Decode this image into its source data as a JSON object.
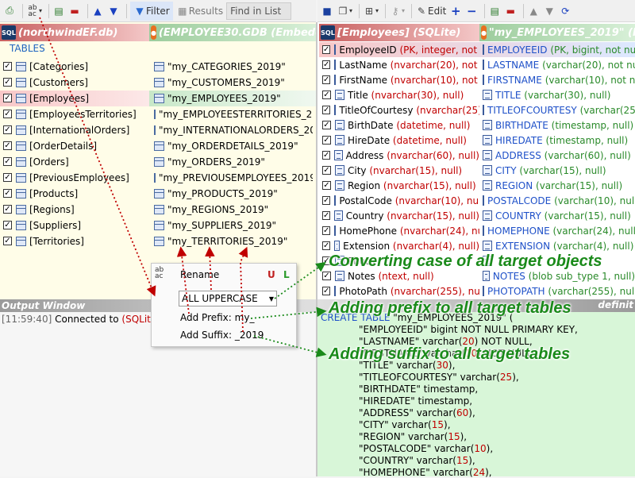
{
  "left_toolbar": {
    "filter_label": "Filter",
    "results_label": "Results",
    "find_placeholder": "Find in List"
  },
  "right_toolbar": {
    "edit_label": "Edit"
  },
  "source_db": {
    "title": "(northwindEF.db)",
    "logo_text": "SQL"
  },
  "target_db": {
    "title": "(EMPLOYEE30.GDB (Embedd",
    "logo_text": "●"
  },
  "tables_label": "TABLES",
  "tables": [
    {
      "src": "[Categories]",
      "dst": "\"my_CATEGORIES_2019\""
    },
    {
      "src": "[Customers]",
      "dst": "\"my_CUSTOMERS_2019\""
    },
    {
      "src": "[Employees]",
      "dst": "\"my_EMPLOYEES_2019\""
    },
    {
      "src": "[EmployeesTerritories]",
      "dst": "\"my_EMPLOYEESTERRITORIES_2019\""
    },
    {
      "src": "[InternationalOrders]",
      "dst": "\"my_INTERNATIONALORDERS_2019\""
    },
    {
      "src": "[OrderDetails]",
      "dst": "\"my_ORDERDETAILS_2019\""
    },
    {
      "src": "[Orders]",
      "dst": "\"my_ORDERS_2019\""
    },
    {
      "src": "[PreviousEmployees]",
      "dst": "\"my_PREVIOUSEMPLOYEES_2019\""
    },
    {
      "src": "[Products]",
      "dst": "\"my_PRODUCTS_2019\""
    },
    {
      "src": "[Regions]",
      "dst": "\"my_REGIONS_2019\""
    },
    {
      "src": "[Suppliers]",
      "dst": "\"my_SUPPLIERS_2019\""
    },
    {
      "src": "[Territories]",
      "dst": "\"my_TERRITORIES_2019\""
    }
  ],
  "src_table_header": "[Employees] (SQLite)",
  "dst_table_header": "\"my_EMPLOYEES_2019\" (Fir",
  "fields": [
    {
      "name": "EmployeeID",
      "stype": "(PK, integer, not nu",
      "dname": "EMPLOYEEID",
      "dtype": "(PK, bigint, not null"
    },
    {
      "name": "LastName",
      "stype": "(nvarchar(20), not nu",
      "dname": "LASTNAME",
      "dtype": "(varchar(20), not null"
    },
    {
      "name": "FirstName",
      "stype": "(nvarchar(10), not nu",
      "dname": "FIRSTNAME",
      "dtype": "(varchar(10), not null"
    },
    {
      "name": "Title",
      "stype": "(nvarchar(30), null)",
      "dname": "TITLE",
      "dtype": "(varchar(30), null)"
    },
    {
      "name": "TitleOfCourtesy",
      "stype": "(nvarchar(25), r",
      "dname": "TITLEOFCOURTESY",
      "dtype": "(varchar(25), n"
    },
    {
      "name": "BirthDate",
      "stype": "(datetime, null)",
      "dname": "BIRTHDATE",
      "dtype": "(timestamp, null)"
    },
    {
      "name": "HireDate",
      "stype": "(datetime, null)",
      "dname": "HIREDATE",
      "dtype": "(timestamp, null)"
    },
    {
      "name": "Address",
      "stype": "(nvarchar(60), null)",
      "dname": "ADDRESS",
      "dtype": "(varchar(60), null)"
    },
    {
      "name": "City",
      "stype": "(nvarchar(15), null)",
      "dname": "CITY",
      "dtype": "(varchar(15), null)"
    },
    {
      "name": "Region",
      "stype": "(nvarchar(15), null)",
      "dname": "REGION",
      "dtype": "(varchar(15), null)"
    },
    {
      "name": "PostalCode",
      "stype": "(nvarchar(10), null)",
      "dname": "POSTALCODE",
      "dtype": "(varchar(10), null)"
    },
    {
      "name": "Country",
      "stype": "(nvarchar(15), null)",
      "dname": "COUNTRY",
      "dtype": "(varchar(15), null)"
    },
    {
      "name": "HomePhone",
      "stype": "(nvarchar(24), null)",
      "dname": "HOMEPHONE",
      "dtype": "(varchar(24), null)"
    },
    {
      "name": "Extension",
      "stype": "(nvarchar(4), null)",
      "dname": "EXTENSION",
      "dtype": "(varchar(4), null)"
    },
    {
      "name": "Photo",
      "stype": "",
      "dname": "",
      "dtype": ""
    },
    {
      "name": "Notes",
      "stype": "(ntext, null)",
      "dname": "NOTES",
      "dtype": "(blob sub_type 1, null)"
    },
    {
      "name": "PhotoPath",
      "stype": "(nvarchar(255), null)",
      "dname": "PHOTOPATH",
      "dtype": "(varchar(255), null"
    }
  ],
  "output": {
    "title": "Output Window",
    "time": "[11:59:40]",
    "msg": "Connected to",
    "db": "(SQLite) nor"
  },
  "definition_label": "definit",
  "rename_popup": {
    "title": "Rename",
    "u": "U",
    "l": "L",
    "case_value": "ALL UPPERCASE",
    "prefix_label": "Add Prefix:",
    "prefix_value": "my_",
    "suffix_label": "Add Suffix:",
    "suffix_value": "_2019"
  },
  "sql_lines": [
    {
      "a": "CREATE TABLE",
      "b": " \"my_EMPLOYEES_2019\" ("
    },
    {
      "a": "\"EMPLOYEEID\" bigint",
      "b": " NOT NULL PRIMARY KEY,"
    },
    {
      "a": "\"LASTNAME\" varchar(",
      "n": "20",
      "b": ") NOT NULL,"
    },
    {
      "a": "\"FIRSTNAME\" varchar(",
      "n": "10",
      "b": ") NOT NULL,"
    },
    {
      "a": "\"TITLE\" varchar(",
      "n": "30",
      "b": "),"
    },
    {
      "a": "\"TITLEOFCOURTESY\" varchar(",
      "n": "25",
      "b": "),"
    },
    {
      "a": "\"BIRTHDATE\" timestamp,"
    },
    {
      "a": "\"HIREDATE\" timestamp,"
    },
    {
      "a": "\"ADDRESS\" varchar(",
      "n": "60",
      "b": "),"
    },
    {
      "a": "\"CITY\" varchar(",
      "n": "15",
      "b": "),"
    },
    {
      "a": "\"REGION\" varchar(",
      "n": "15",
      "b": "),"
    },
    {
      "a": "\"POSTALCODE\" varchar(",
      "n": "10",
      "b": "),"
    },
    {
      "a": "\"COUNTRY\" varchar(",
      "n": "15",
      "b": "),"
    },
    {
      "a": "\"HOMEPHONE\" varchar(",
      "n": "24",
      "b": "),"
    }
  ],
  "annotations": {
    "case": "Converting case of all target objects",
    "prefix": "Adding prefix to all target tables",
    "suffix": "Adding suffix to all target tables"
  },
  "colors": {
    "header_red": "#e88888",
    "header_green": "#a8d8a8",
    "selected_row": "#f8d8d8",
    "code_bg": "#d8f6d8",
    "annotation": "#1a8a1a"
  }
}
